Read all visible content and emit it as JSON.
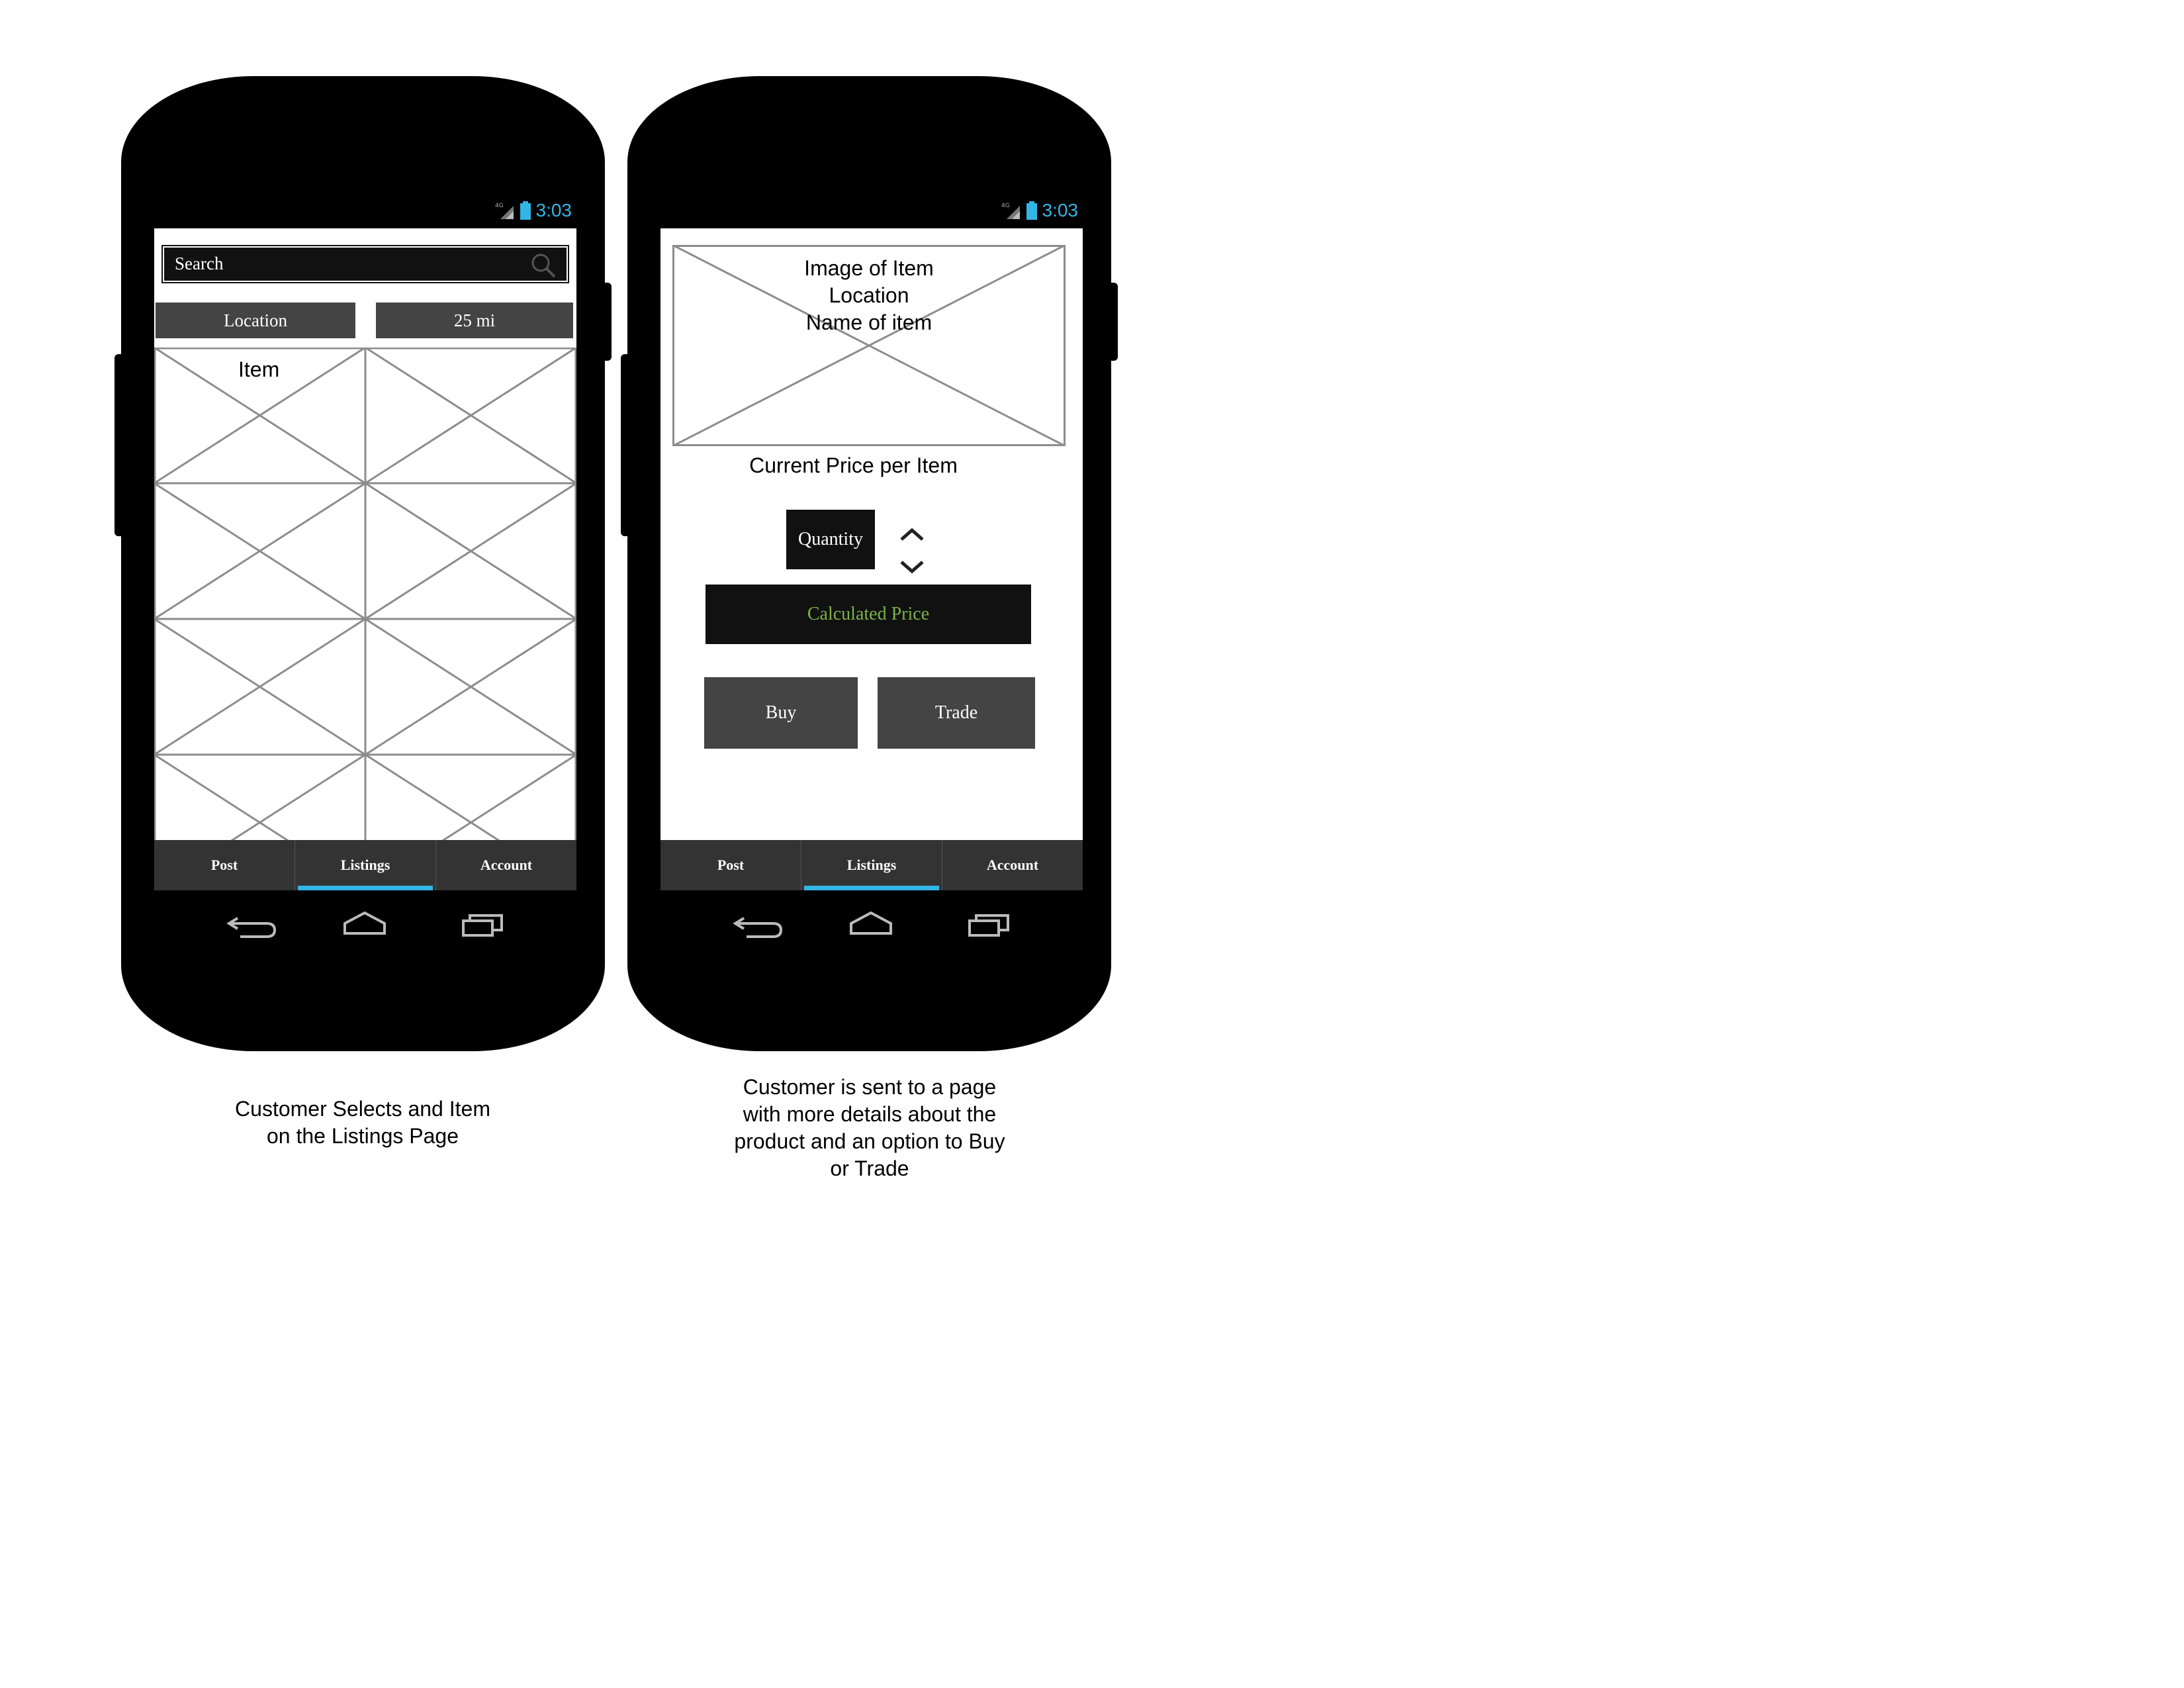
{
  "status_bar": {
    "network": "4G",
    "time": "3:03"
  },
  "listings_screen": {
    "search_placeholder": "Search",
    "location_label": "Location",
    "distance_label": "25 mi",
    "item_label": "Item"
  },
  "detail_screen": {
    "hero_lines": [
      "Image of Item",
      "Location",
      "Name of item"
    ],
    "price_label": "Current Price per Item",
    "quantity_label": "Quantity",
    "calculated_price_label": "Calculated Price",
    "buy_label": "Buy",
    "trade_label": "Trade"
  },
  "tabs": [
    {
      "label": "Post",
      "active": false
    },
    {
      "label": "Listings",
      "active": true
    },
    {
      "label": "Account",
      "active": false
    }
  ],
  "captions": {
    "left": [
      "Customer Selects and Item",
      "on the Listings Page"
    ],
    "right": [
      "Customer is sent to a page",
      "with more details about the",
      "product and an option to Buy",
      "or Trade"
    ]
  },
  "colors": {
    "accent": "#33b5e5",
    "calc_text": "#7bb34a",
    "button_bg": "#444444",
    "dark_bg": "#111111"
  },
  "icons": [
    "search-icon",
    "signal-icon",
    "battery-icon",
    "back-icon",
    "home-icon",
    "recents-icon",
    "chevron-up-icon",
    "chevron-down-icon"
  ]
}
